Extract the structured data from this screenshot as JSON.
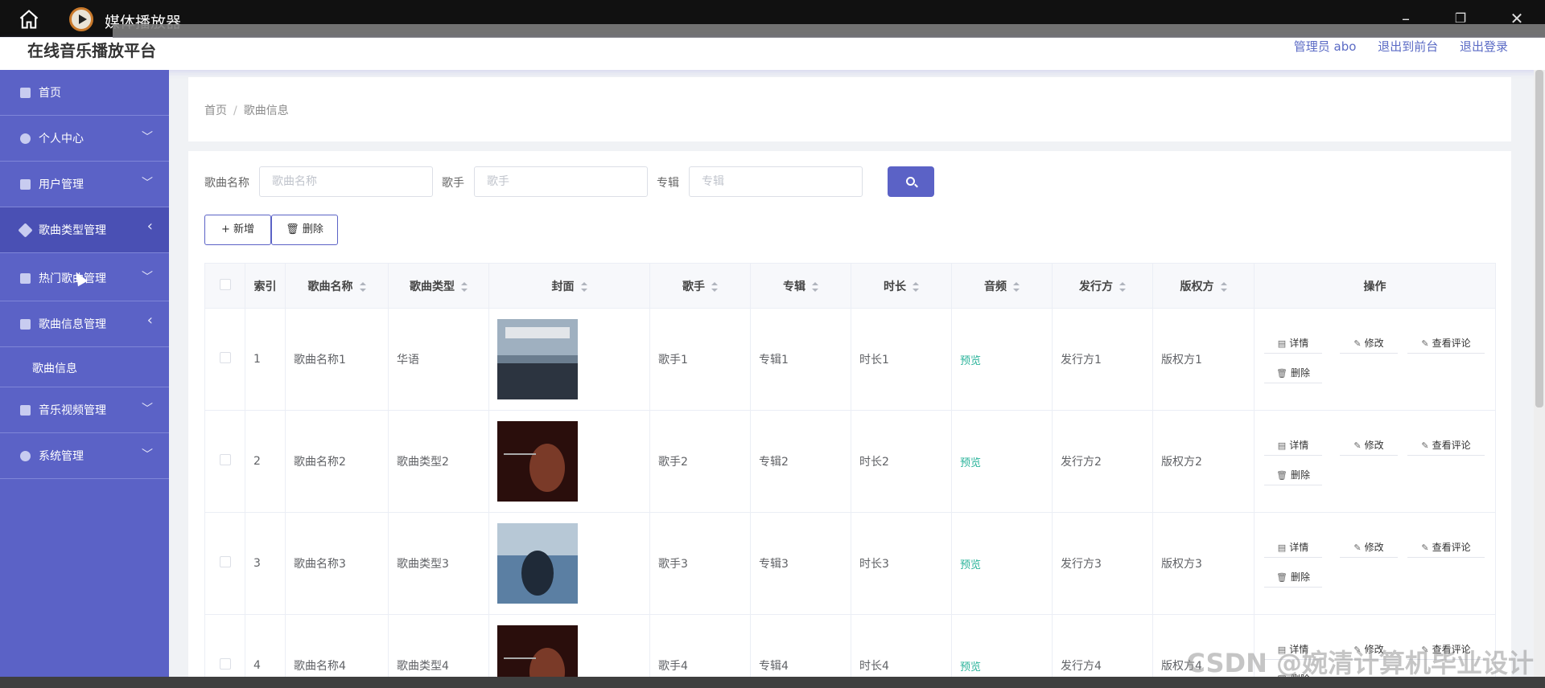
{
  "window": {
    "title": "媒体播放器",
    "minimize": "–",
    "maximize": "❐",
    "close": "✕"
  },
  "header": {
    "brand": "在线音乐播放平台",
    "admin": "管理员 abo",
    "to_front": "退出到前台",
    "logout": "退出登录"
  },
  "sidebar": {
    "items": [
      {
        "label": "首页",
        "icon": "home-icon",
        "arrow": ""
      },
      {
        "label": "个人中心",
        "icon": "user-icon",
        "arrow": "﹀"
      },
      {
        "label": "用户管理",
        "icon": "list-icon",
        "arrow": "﹀"
      },
      {
        "label": "歌曲类型管理",
        "icon": "send-icon",
        "arrow": "‹"
      },
      {
        "label": "热门歌曲管理",
        "icon": "hot-icon",
        "arrow": "﹀"
      },
      {
        "label": "歌曲信息管理",
        "icon": "ticket-icon",
        "arrow": "‹"
      },
      {
        "label": "音乐视频管理",
        "icon": "grid-icon",
        "arrow": "﹀"
      },
      {
        "label": "系统管理",
        "icon": "user-icon",
        "arrow": "﹀"
      }
    ],
    "submenu": "歌曲信息"
  },
  "breadcrumb": {
    "home": "首页",
    "sep": "/",
    "current": "歌曲信息"
  },
  "search": {
    "song_name_label": "歌曲名称",
    "song_name_placeholder": "歌曲名称",
    "singer_label": "歌手",
    "singer_placeholder": "歌手",
    "album_label": "专辑",
    "album_placeholder": "专辑"
  },
  "actions": {
    "add": "+ 新增",
    "delete": "删除"
  },
  "table": {
    "headers": [
      "索引",
      "歌曲名称",
      "歌曲类型",
      "封面",
      "歌手",
      "专辑",
      "时长",
      "音频",
      "发行方",
      "版权方",
      "操作"
    ],
    "rows": [
      {
        "index": "1",
        "name": "歌曲名称1",
        "type": "华语",
        "singer": "歌手1",
        "album": "专辑1",
        "duration": "时长1",
        "audio": "预览",
        "publisher": "发行方1",
        "copyright": "版权方1"
      },
      {
        "index": "2",
        "name": "歌曲名称2",
        "type": "歌曲类型2",
        "singer": "歌手2",
        "album": "专辑2",
        "duration": "时长2",
        "audio": "预览",
        "publisher": "发行方2",
        "copyright": "版权方2"
      },
      {
        "index": "3",
        "name": "歌曲名称3",
        "type": "歌曲类型3",
        "singer": "歌手3",
        "album": "专辑3",
        "duration": "时长3",
        "audio": "预览",
        "publisher": "发行方3",
        "copyright": "版权方3"
      },
      {
        "index": "4",
        "name": "歌曲名称4",
        "type": "歌曲类型4",
        "singer": "歌手4",
        "album": "专辑4",
        "duration": "时长4",
        "audio": "预览",
        "publisher": "发行方4",
        "copyright": "版权方4"
      }
    ],
    "ops": {
      "detail": "详情",
      "edit": "修改",
      "comments": "查看评论",
      "delete": "删除"
    }
  },
  "watermark": "CSDN @婉清计算机毕业设计",
  "colors": {
    "accent": "#5b62c6",
    "preview": "#2ab39a"
  }
}
